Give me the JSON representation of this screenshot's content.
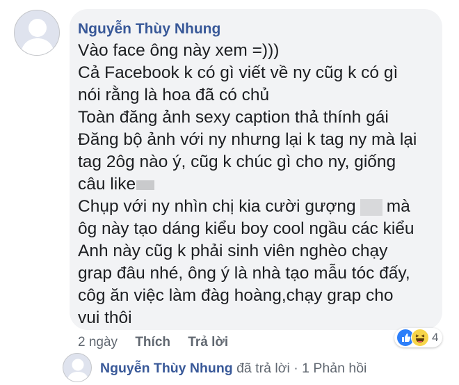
{
  "comment": {
    "author": "Nguyễn Thùy Nhung",
    "lines": [
      "Vào face ông này xem =)))",
      "Cả Facebook k có gì viết về ny cũg k có gì",
      "nói rằng là hoa đã có chủ",
      "Toàn đăng ảnh sexy caption thả thính gái",
      "Đăng bộ ảnh với ny nhưng lại k tag ny mà lại",
      "tag 2ôg nào ý, cũg k chúc gì cho ny, giống",
      "câu like",
      "Chụp với ny nhìn chị kia cười gượng",
      "mà",
      "ôg này tạo dáng kiểu boy cool ngầu các kiểu",
      "Anh này cũg k phải sinh viên nghèo chạy",
      "grap đâu nhé, ông ý là nhà tạo mẫu tóc đấy,",
      "côg ăn việc làm đàg hoàng,chạy grap cho",
      "vui thôi"
    ]
  },
  "actions": {
    "time": "2 ngày",
    "like": "Thích",
    "reply": "Trả lời"
  },
  "reactions": {
    "icons": [
      "like-icon",
      "haha-icon"
    ],
    "count": "4"
  },
  "reply_summary": {
    "author": "Nguyễn Thùy Nhung",
    "text": "đã trả lời · 1 Phản hồi"
  }
}
